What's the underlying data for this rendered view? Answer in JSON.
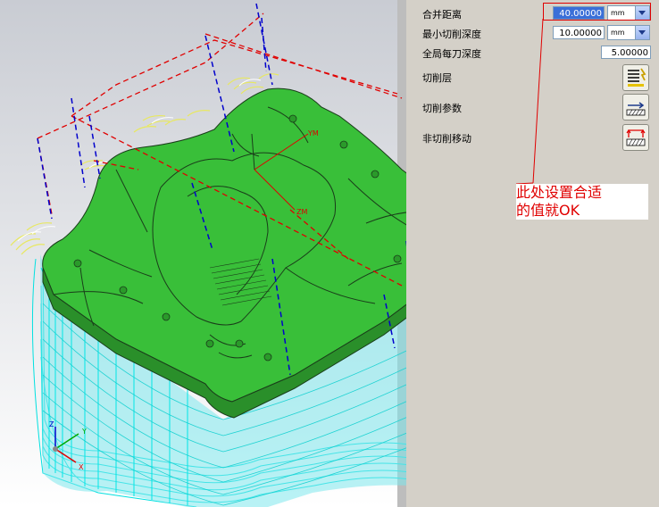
{
  "panel": {
    "rows": [
      {
        "label": "合并距离",
        "value": "40.00000",
        "unit": "mm"
      },
      {
        "label": "最小切削深度",
        "value": "10.00000",
        "unit": "mm"
      },
      {
        "label": "全局每刀深度",
        "value": "5.00000"
      }
    ],
    "cut_levels_label": "切削层",
    "cut_params_label": "切削参数",
    "noncut_moves_label": "非切削移动"
  },
  "annotation": {
    "line1": "此处设置合适",
    "line2": "的值就OK"
  },
  "axes": {
    "z": "Z",
    "y": "Y",
    "x": "X"
  },
  "part_labels": {
    "zm": "ZM",
    "ym": "YM"
  },
  "colors": {
    "part": "#2db82d",
    "toolpath": "#00e6e6",
    "engage": "#f0f060",
    "rapid": "#e00000",
    "plunge": "#0000cc",
    "annotation": "#e00000"
  }
}
